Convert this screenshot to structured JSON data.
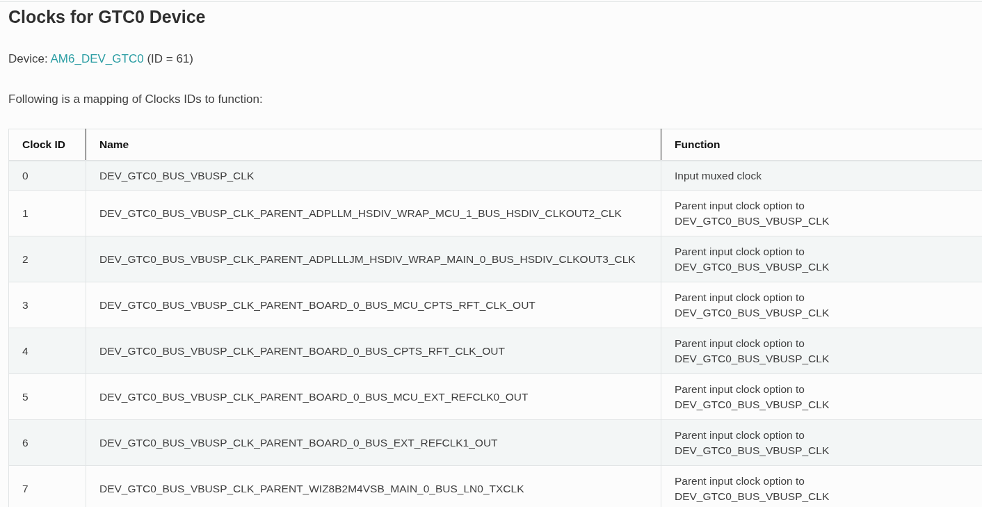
{
  "heading": "Clocks for GTC0 Device",
  "device_line": {
    "label": "Device:",
    "link": "AM6_DEV_GTC0",
    "suffix": "(ID = 61)"
  },
  "intro": "Following is a mapping of Clocks IDs to function:",
  "table": {
    "columns": [
      "Clock ID",
      "Name",
      "Function"
    ],
    "rows": [
      [
        "0",
        "DEV_GTC0_BUS_VBUSP_CLK",
        "Input muxed clock"
      ],
      [
        "1",
        "DEV_GTC0_BUS_VBUSP_CLK_PARENT_ADPLLM_HSDIV_WRAP_MCU_1_BUS_HSDIV_CLKOUT2_CLK",
        "Parent input clock option to DEV_GTC0_BUS_VBUSP_CLK"
      ],
      [
        "2",
        "DEV_GTC0_BUS_VBUSP_CLK_PARENT_ADPLLLJM_HSDIV_WRAP_MAIN_0_BUS_HSDIV_CLKOUT3_CLK",
        "Parent input clock option to DEV_GTC0_BUS_VBUSP_CLK"
      ],
      [
        "3",
        "DEV_GTC0_BUS_VBUSP_CLK_PARENT_BOARD_0_BUS_MCU_CPTS_RFT_CLK_OUT",
        "Parent input clock option to DEV_GTC0_BUS_VBUSP_CLK"
      ],
      [
        "4",
        "DEV_GTC0_BUS_VBUSP_CLK_PARENT_BOARD_0_BUS_CPTS_RFT_CLK_OUT",
        "Parent input clock option to DEV_GTC0_BUS_VBUSP_CLK"
      ],
      [
        "5",
        "DEV_GTC0_BUS_VBUSP_CLK_PARENT_BOARD_0_BUS_MCU_EXT_REFCLK0_OUT",
        "Parent input clock option to DEV_GTC0_BUS_VBUSP_CLK"
      ],
      [
        "6",
        "DEV_GTC0_BUS_VBUSP_CLK_PARENT_BOARD_0_BUS_EXT_REFCLK1_OUT",
        "Parent input clock option to DEV_GTC0_BUS_VBUSP_CLK"
      ],
      [
        "7",
        "DEV_GTC0_BUS_VBUSP_CLK_PARENT_WIZ8B2M4VSB_MAIN_0_BUS_LN0_TXCLK",
        "Parent input clock option to DEV_GTC0_BUS_VBUSP_CLK"
      ]
    ]
  }
}
